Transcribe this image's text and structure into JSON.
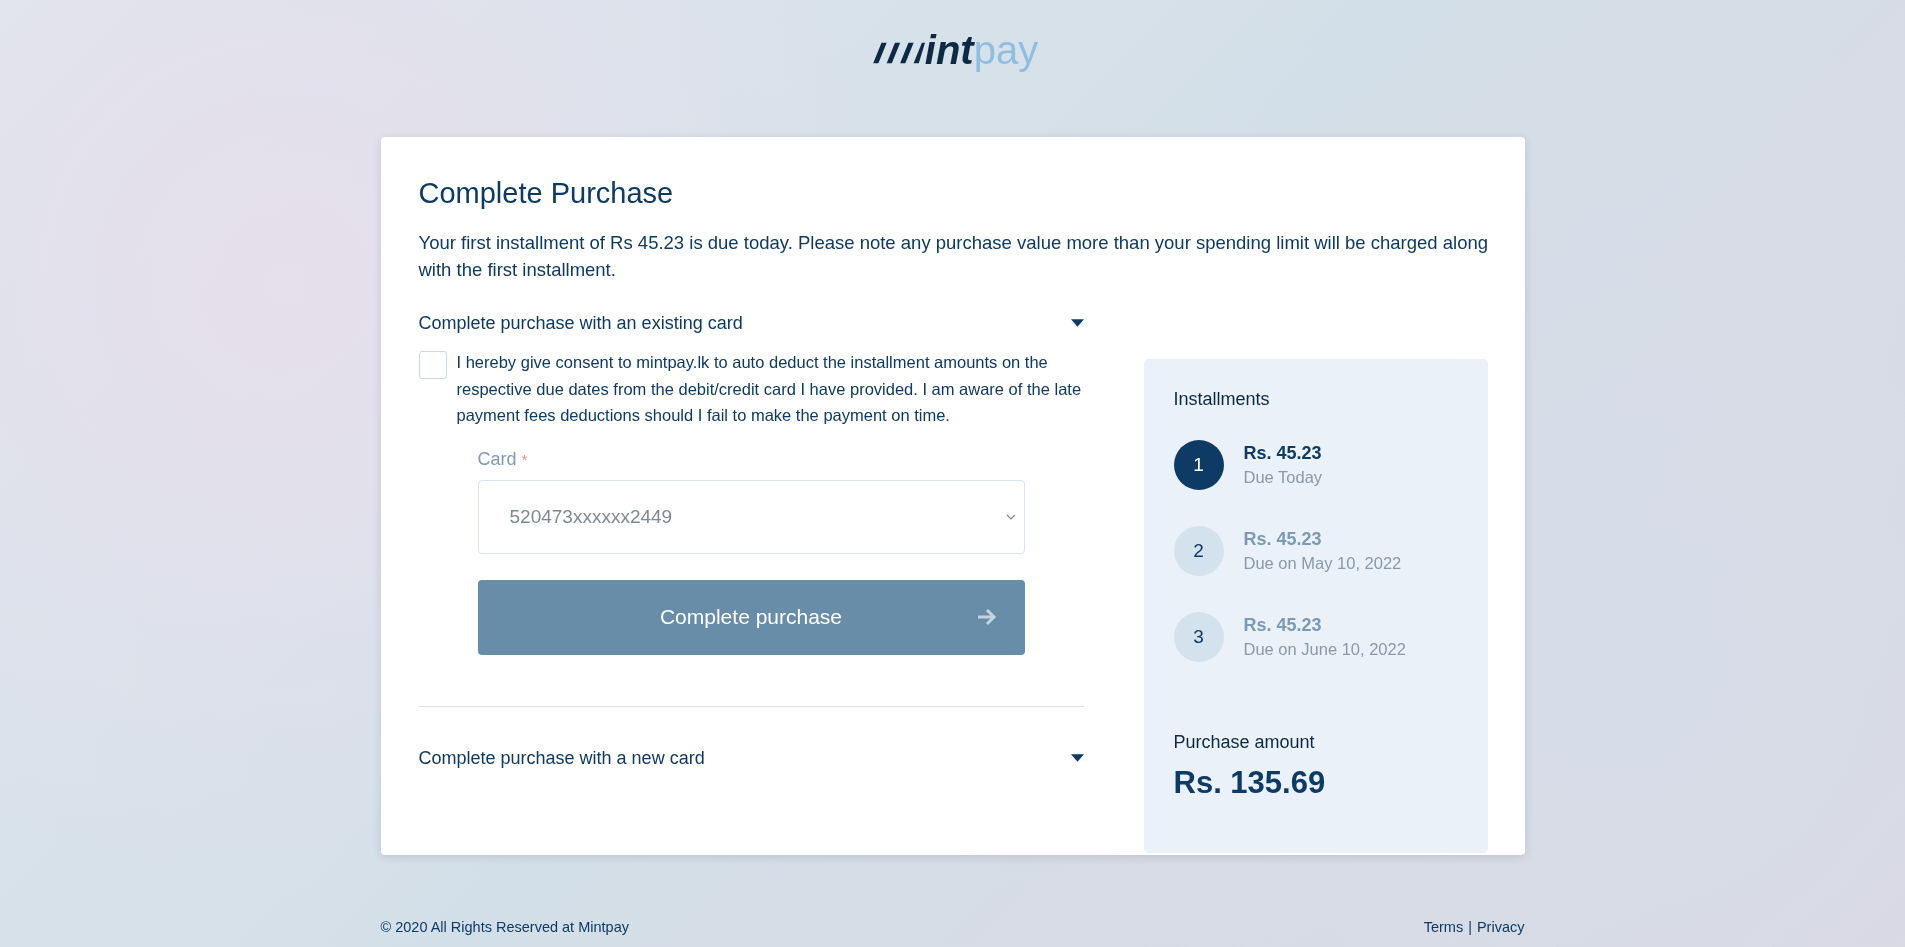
{
  "logo": {
    "text_dark": "int",
    "text_light": "pay"
  },
  "card": {
    "title": "Complete Purchase",
    "notice": "Your first installment of Rs 45.23 is due today. Please note any purchase value more than your spending limit will be charged along with the first installment."
  },
  "existing_card": {
    "header": "Complete purchase with an existing card",
    "expanded": true,
    "consent": {
      "checked": false,
      "text": "I hereby give consent to mintpay.lk to auto deduct the installment amounts on the respective due dates from the debit/credit card I have provided. I am aware of the late payment fees deductions should I fail to make the payment on time."
    },
    "card_label": "Card",
    "required_mark": "*",
    "card_value": "520473xxxxxx2449",
    "button": {
      "label": "Complete purchase",
      "disabled": true
    }
  },
  "new_card": {
    "header": "Complete purchase with a new card",
    "expanded": false
  },
  "installments": {
    "title": "Installments",
    "items": [
      {
        "number": "1",
        "amount": "Rs. 45.23",
        "due": "Due Today",
        "current": true
      },
      {
        "number": "2",
        "amount": "Rs. 45.23",
        "due": "Due on May 10, 2022",
        "current": false
      },
      {
        "number": "3",
        "amount": "Rs. 45.23",
        "due": "Due on June 10, 2022",
        "current": false
      }
    ],
    "total_label": "Purchase amount",
    "total": "Rs. 135.69"
  },
  "footer": {
    "copyright": "© 2020 All Rights Reserved at Mintpay",
    "links": [
      "Terms",
      "Privacy"
    ],
    "separator": "|"
  }
}
